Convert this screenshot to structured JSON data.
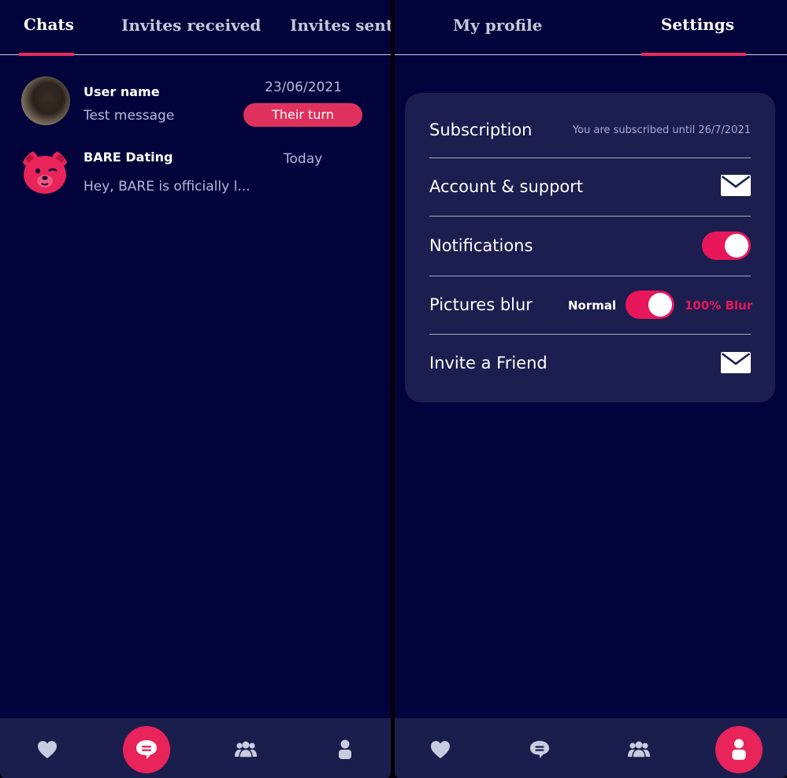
{
  "colors": {
    "background": "#01033a",
    "card": "#1b1e4e",
    "accent": "#e8175c",
    "muted_text": "#b5b8dc"
  },
  "chats_screen": {
    "tabs": [
      {
        "label": "Chats",
        "active": true
      },
      {
        "label": "Invites received",
        "active": false
      },
      {
        "label": "Invites sent",
        "active": false
      }
    ],
    "chats": [
      {
        "name": "User name",
        "message": "Test message",
        "date": "23/06/2021",
        "badge": "Their turn",
        "avatar": "user-photo"
      },
      {
        "name": "BARE Dating",
        "message": "Hey, BARE is officially l...",
        "date": "Today",
        "avatar": "bear-logo-icon"
      }
    ],
    "bottom_nav": [
      {
        "icon": "heart-icon",
        "active": false
      },
      {
        "icon": "chat-icon",
        "active": true
      },
      {
        "icon": "group-icon",
        "active": false
      },
      {
        "icon": "profile-icon",
        "active": false
      }
    ]
  },
  "settings_screen": {
    "tabs": [
      {
        "label": "My profile",
        "active": false
      },
      {
        "label": "Settings",
        "active": true
      }
    ],
    "rows": {
      "subscription": {
        "label": "Subscription",
        "value": "You are subscribed until 26/7/2021"
      },
      "account": {
        "label": "Account & support",
        "icon": "mail-icon"
      },
      "notifications": {
        "label": "Notifications",
        "toggle_on": true
      },
      "blur": {
        "label": "Pictures blur",
        "left_option": "Normal",
        "right_option": "100% Blur",
        "toggle_on": true
      },
      "invite": {
        "label": "Invite a Friend",
        "icon": "mail-icon"
      }
    },
    "bottom_nav": [
      {
        "icon": "heart-icon",
        "active": false
      },
      {
        "icon": "chat-icon",
        "active": false
      },
      {
        "icon": "group-icon",
        "active": false
      },
      {
        "icon": "profile-icon",
        "active": true
      }
    ]
  }
}
